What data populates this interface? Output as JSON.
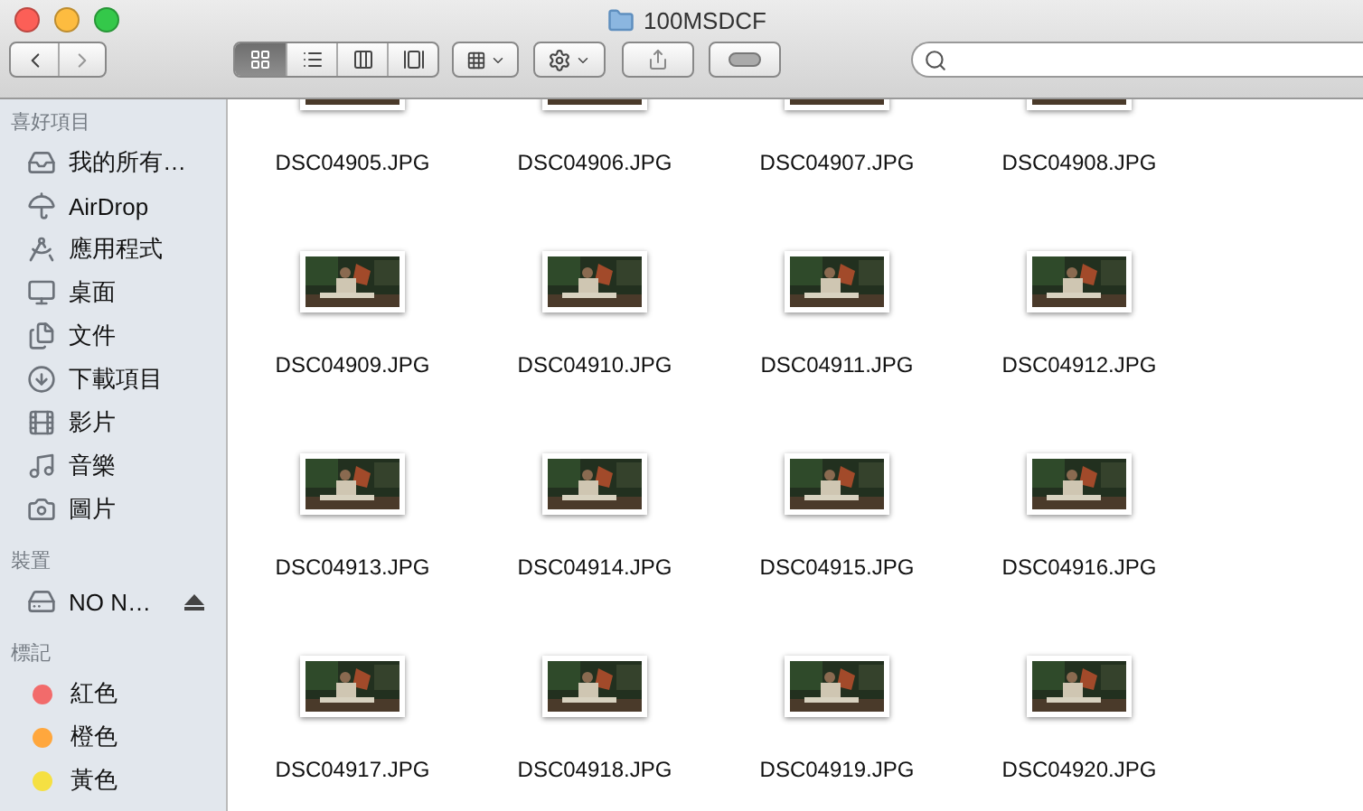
{
  "window": {
    "title": "100MSDCF"
  },
  "toolbar": {
    "view_buttons": [
      {
        "selected": true
      },
      {
        "selected": false
      },
      {
        "selected": false
      },
      {
        "selected": false
      }
    ]
  },
  "sidebar": {
    "sections": [
      {
        "title": "喜好項目",
        "items": [
          {
            "kind": "place",
            "label": "我的所有…"
          },
          {
            "kind": "place",
            "label": "AirDrop"
          },
          {
            "kind": "place",
            "label": "應用程式"
          },
          {
            "kind": "place",
            "label": "桌面"
          },
          {
            "kind": "place",
            "label": "文件"
          },
          {
            "kind": "place",
            "label": "下載項目"
          },
          {
            "kind": "place",
            "label": "影片"
          },
          {
            "kind": "place",
            "label": "音樂"
          },
          {
            "kind": "place",
            "label": "圖片"
          }
        ]
      },
      {
        "title": "裝置",
        "items": [
          {
            "kind": "device",
            "label": "NO N…"
          }
        ]
      },
      {
        "title": "標記",
        "items": [
          {
            "kind": "tag",
            "label": "紅色",
            "color": "#f26b6b"
          },
          {
            "kind": "tag",
            "label": "橙色",
            "color": "#ffa73d"
          },
          {
            "kind": "tag",
            "label": "黃色",
            "color": "#f5e042"
          }
        ]
      }
    ]
  },
  "files": [
    "DSC04905.JPG",
    "DSC04906.JPG",
    "DSC04907.JPG",
    "DSC04908.JPG",
    "DSC04909.JPG",
    "DSC04910.JPG",
    "DSC04911.JPG",
    "DSC04912.JPG",
    "DSC04913.JPG",
    "DSC04914.JPG",
    "DSC04915.JPG",
    "DSC04916.JPG",
    "DSC04917.JPG",
    "DSC04918.JPG",
    "DSC04919.JPG",
    "DSC04920.JPG"
  ]
}
